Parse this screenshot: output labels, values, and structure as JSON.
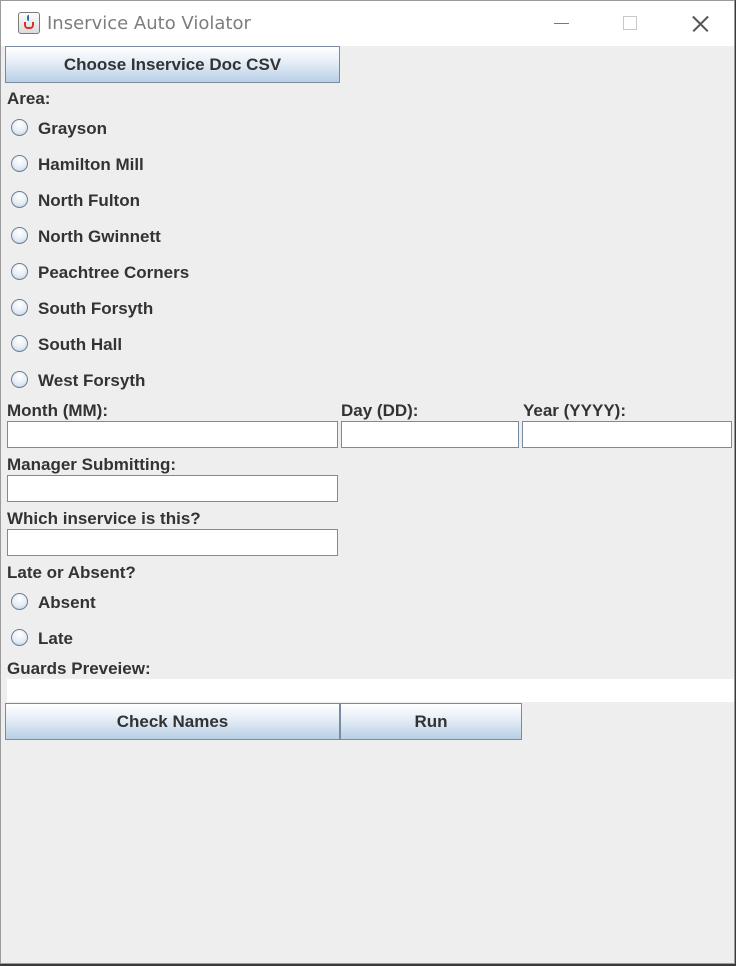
{
  "window": {
    "title": "Inservice Auto Violator"
  },
  "choose_csv_button": "Choose Inservice Doc CSV",
  "area": {
    "label": "Area:",
    "options": [
      "Grayson",
      "Hamilton Mill",
      "North Fulton",
      "North Gwinnett",
      "Peachtree Corners",
      "South Forsyth",
      "South Hall",
      "West Forsyth"
    ]
  },
  "date": {
    "month_label": "Month (MM):",
    "day_label": "Day (DD):",
    "year_label": "Year (YYYY):",
    "month_value": "",
    "day_value": "",
    "year_value": ""
  },
  "manager": {
    "label": "Manager Submitting:",
    "value": ""
  },
  "inservice": {
    "label": "Which inservice is this?",
    "value": ""
  },
  "late_absent": {
    "label": "Late or Absent?",
    "options": [
      "Absent",
      "Late"
    ]
  },
  "guards_preview": {
    "label": "Guards Preveiew:",
    "value": ""
  },
  "buttons": {
    "check_names": "Check Names",
    "run": "Run"
  },
  "colors": {
    "window_bg": "#eeeeee",
    "button_gradient_bottom": "#b8cfe6",
    "text": "#333333"
  }
}
